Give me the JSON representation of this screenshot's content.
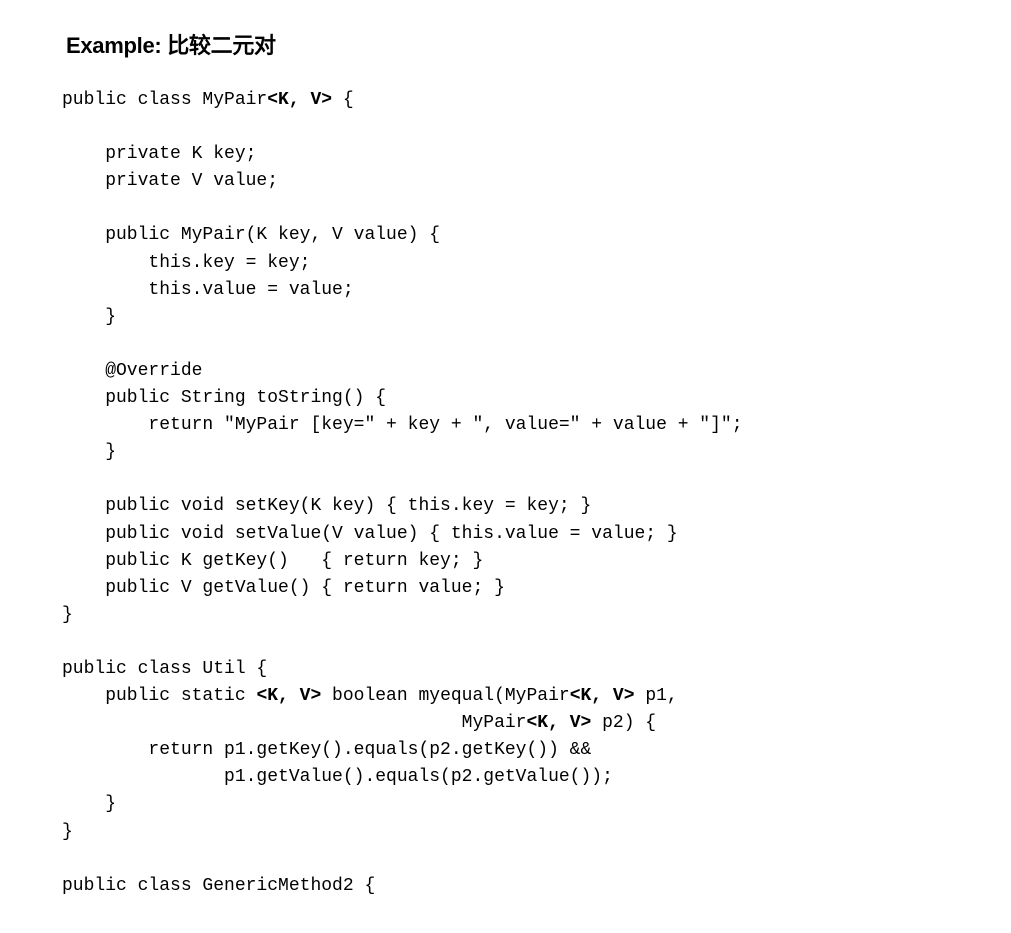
{
  "title": "Example: 比较二元对",
  "code_lines": [
    [
      {
        "t": "public class MyPair"
      },
      {
        "t": "<K, V>",
        "b": true
      },
      {
        "t": " {"
      }
    ],
    [
      {
        "t": ""
      }
    ],
    [
      {
        "t": "    private K key;"
      }
    ],
    [
      {
        "t": "    private V value;"
      }
    ],
    [
      {
        "t": ""
      }
    ],
    [
      {
        "t": "    public MyPair(K key, V value) {"
      }
    ],
    [
      {
        "t": "        this.key = key;"
      }
    ],
    [
      {
        "t": "        this.value = value;"
      }
    ],
    [
      {
        "t": "    }"
      }
    ],
    [
      {
        "t": ""
      }
    ],
    [
      {
        "t": "    @Override"
      }
    ],
    [
      {
        "t": "    public String toString() {"
      }
    ],
    [
      {
        "t": "        return \"MyPair [key=\" + key + \", value=\" + value + \"]\";"
      }
    ],
    [
      {
        "t": "    }"
      }
    ],
    [
      {
        "t": ""
      }
    ],
    [
      {
        "t": "    public void setKey(K key) { this.key = key; }"
      }
    ],
    [
      {
        "t": "    public void setValue(V value) { this.value = value; }"
      }
    ],
    [
      {
        "t": "    public K getKey()   { return key; }"
      }
    ],
    [
      {
        "t": "    public V getValue() { return value; }"
      }
    ],
    [
      {
        "t": "}"
      }
    ],
    [
      {
        "t": ""
      }
    ],
    [
      {
        "t": "public class Util {"
      }
    ],
    [
      {
        "t": "    public static "
      },
      {
        "t": "<K, V>",
        "b": true
      },
      {
        "t": " boolean myequal(MyPair"
      },
      {
        "t": "<K, V>",
        "b": true
      },
      {
        "t": " p1,"
      }
    ],
    [
      {
        "t": "                                     MyPair"
      },
      {
        "t": "<K, V>",
        "b": true
      },
      {
        "t": " p2) {"
      }
    ],
    [
      {
        "t": "        return p1.getKey().equals(p2.getKey()) &&"
      }
    ],
    [
      {
        "t": "               p1.getValue().equals(p2.getValue());"
      }
    ],
    [
      {
        "t": "    }"
      }
    ],
    [
      {
        "t": "}"
      }
    ],
    [
      {
        "t": ""
      }
    ],
    [
      {
        "t": "public class GenericMethod2 {"
      }
    ]
  ]
}
